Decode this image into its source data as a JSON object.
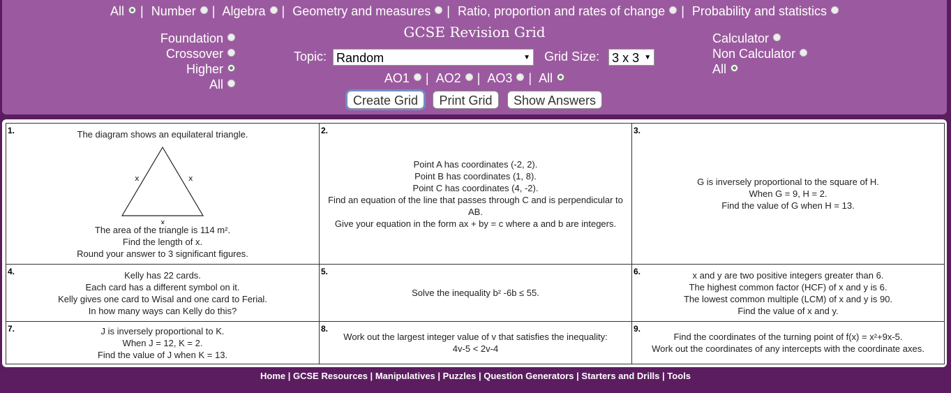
{
  "strands": [
    {
      "label": "All",
      "selected": true
    },
    {
      "label": "Number",
      "selected": false
    },
    {
      "label": "Algebra",
      "selected": false
    },
    {
      "label": "Geometry and measures",
      "selected": false
    },
    {
      "label": "Ratio, proportion and rates of change",
      "selected": false
    },
    {
      "label": "Probability and statistics",
      "selected": false
    }
  ],
  "title": "GCSE Revision Grid",
  "tiers": [
    {
      "label": "Foundation",
      "selected": false
    },
    {
      "label": "Crossover",
      "selected": false
    },
    {
      "label": "Higher",
      "selected": true
    },
    {
      "label": "All",
      "selected": false
    }
  ],
  "calculator": [
    {
      "label": "Calculator",
      "selected": false
    },
    {
      "label": "Non Calculator",
      "selected": false
    },
    {
      "label": "All",
      "selected": true
    }
  ],
  "topic": {
    "label": "Topic:",
    "value": "Random"
  },
  "grid_size": {
    "label": "Grid Size:",
    "value": "3 x 3"
  },
  "ao": [
    {
      "label": "AO1",
      "selected": false
    },
    {
      "label": "AO2",
      "selected": false
    },
    {
      "label": "AO3",
      "selected": false
    },
    {
      "label": "All",
      "selected": true
    }
  ],
  "buttons": {
    "create": "Create Grid",
    "print": "Print Grid",
    "answers": "Show Answers"
  },
  "questions": [
    {
      "num": "1.",
      "lines_top": [
        "The diagram shows an equilateral triangle."
      ],
      "diagram_labels": [
        "x",
        "x",
        "x"
      ],
      "lines": [
        "The area of the triangle is 114 m².",
        "Find the length of x.",
        "Round your answer to 3 significant figures."
      ]
    },
    {
      "num": "2.",
      "lines": [
        "Point A has coordinates (-2, 2).",
        "Point B has coordinates (1, 8).",
        "Point C has coordinates (4, -2).",
        "Find an equation of the line that passes through C and is perpendicular to AB.",
        "Give your equation in the form ax + by = c where a and b are integers."
      ]
    },
    {
      "num": "3.",
      "lines": [
        "G is inversely proportional to the square of H.",
        "When G = 9, H = 2.",
        "Find the value of G when H = 13."
      ]
    },
    {
      "num": "4.",
      "lines": [
        "Kelly has 22 cards.",
        "Each card has a different symbol on it.",
        "Kelly gives one card to Wisal and one card to Ferial.",
        "In how many ways can Kelly do this?"
      ]
    },
    {
      "num": "5.",
      "lines": [
        "Solve the inequality b² -6b ≤ 55."
      ]
    },
    {
      "num": "6.",
      "lines": [
        "x and y are two positive integers greater than 6.",
        "The highest common factor (HCF) of x and y is 6.",
        "The lowest common multiple (LCM) of x and y is 90.",
        "Find the value of x and y."
      ]
    },
    {
      "num": "7.",
      "lines": [
        "J is inversely proportional to K.",
        "When J = 12, K = 2.",
        "Find the value of J when K = 13."
      ]
    },
    {
      "num": "8.",
      "lines": [
        "Work out the largest integer value of v that satisfies the inequality:",
        "4v-5 < 2v-4"
      ]
    },
    {
      "num": "9.",
      "lines": [
        "Find the coordinates of the turning point of f(x) = x²+9x-5.",
        "Work out the coordinates of any intercepts with the coordinate axes."
      ]
    }
  ],
  "footer": [
    "Home",
    "GCSE Resources",
    "Manipulatives",
    "Puzzles",
    "Question Generators",
    "Starters and Drills",
    "Tools"
  ]
}
